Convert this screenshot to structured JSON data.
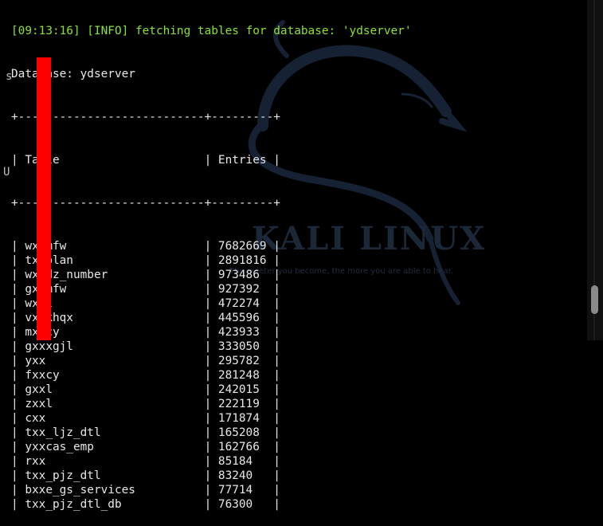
{
  "terminal": {
    "info_line": "[09:13:16] [INFO] fetching tables for database: 'ydserver'",
    "database_line": "Database: ydserver",
    "border_line": "+---------------------------+---------+",
    "header": {
      "col1": "Table",
      "col2": "Entries"
    },
    "rows": [
      {
        "table": "wxxmfw",
        "entries": "7682669"
      },
      {
        "table": "txxplan",
        "entries": "2891816"
      },
      {
        "table": "wxxdz_number",
        "entries": "973486"
      },
      {
        "table": "gxxmfw",
        "entries": "927392"
      },
      {
        "table": "wxxl",
        "entries": "472274"
      },
      {
        "table": "vxxkhqx",
        "entries": "445596"
      },
      {
        "table": "mxxcy",
        "entries": "423933"
      },
      {
        "table": "gxxxgjl",
        "entries": "333050"
      },
      {
        "table": "yxx",
        "entries": "295782"
      },
      {
        "table": "fxxcy",
        "entries": "281248"
      },
      {
        "table": "gxxl",
        "entries": "242015"
      },
      {
        "table": "zxxl",
        "entries": "222119"
      },
      {
        "table": "cxx",
        "entries": "171874"
      },
      {
        "table": "txx_ljz_dtl",
        "entries": "165208"
      },
      {
        "table": "yxxcas_emp",
        "entries": "162766"
      },
      {
        "table": "rxx",
        "entries": "85184"
      },
      {
        "table": "txx_pjz_dtl",
        "entries": "83240"
      },
      {
        "table": "bxxe_gs_services",
        "entries": "77714"
      },
      {
        "table": "txx_pjz_dtl_db",
        "entries": "76300"
      }
    ]
  },
  "wallpaper": {
    "brand": "KALI LINUX",
    "tagline": "The quieter you become, the more you are able to hear."
  },
  "edge_glyphs": {
    "s": "s",
    "u": "U"
  },
  "colors": {
    "background": "#000000",
    "terminal_text": "#e8e8e8",
    "info_text": "#8ae234",
    "redaction": "#ff0000",
    "dragon": "#162233"
  },
  "icons": {
    "wallpaper_logo": "kali-dragon-icon",
    "scrollbar": "scrollbar"
  }
}
